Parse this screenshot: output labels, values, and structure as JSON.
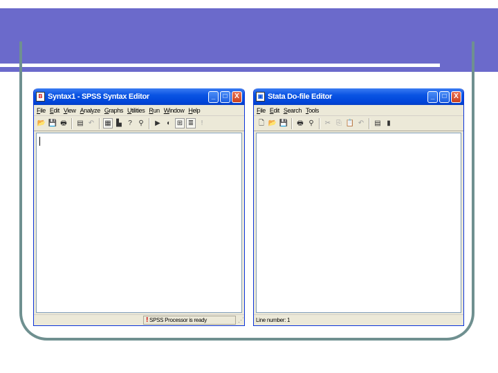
{
  "colors": {
    "slide_banner": "#6b6acb",
    "slide_frame": "#6f9090",
    "xp_titlebar": "#0a54e3",
    "xp_face": "#ece9d8"
  },
  "spss": {
    "title": "Syntax1 - SPSS Syntax Editor",
    "icon_glyph": "B",
    "menu": [
      "File",
      "Edit",
      "View",
      "Analyze",
      "Graphs",
      "Utilities",
      "Run",
      "Window",
      "Help"
    ],
    "toolbar": [
      {
        "icon": "open-folder-icon",
        "glyph": "📂"
      },
      {
        "icon": "save-icon",
        "glyph": "💾"
      },
      {
        "icon": "print-icon",
        "glyph": "🖶"
      },
      {
        "icon": "dialog-recall-icon",
        "glyph": "▤"
      },
      {
        "icon": "undo-icon",
        "glyph": "↶"
      },
      {
        "icon": "goto-data-icon",
        "glyph": "▦"
      },
      {
        "icon": "goto-chart-icon",
        "glyph": "▙"
      },
      {
        "icon": "find-variables-icon",
        "glyph": "?"
      },
      {
        "icon": "find-icon",
        "glyph": "⚲"
      },
      {
        "icon": "run-icon",
        "glyph": "▶"
      },
      {
        "icon": "syntax-help-icon",
        "glyph": "◐"
      },
      {
        "icon": "value-labels-icon",
        "glyph": "⊞"
      },
      {
        "icon": "use-sets-icon",
        "glyph": "≣"
      },
      {
        "icon": "info-icon",
        "glyph": "!"
      }
    ],
    "status": "SPSS Processor is ready",
    "min_glyph": "_",
    "max_glyph": "□",
    "close_glyph": "X",
    "grip_glyph": "⋰"
  },
  "stata": {
    "title": "Stata Do-file Editor",
    "icon_glyph": "▣",
    "menu": [
      "File",
      "Edit",
      "Search",
      "Tools"
    ],
    "toolbar": [
      {
        "icon": "new-file-icon",
        "glyph": "🗋"
      },
      {
        "icon": "open-icon",
        "glyph": "📂"
      },
      {
        "icon": "save-icon",
        "glyph": "💾"
      },
      {
        "icon": "print-icon",
        "glyph": "🖶"
      },
      {
        "icon": "find-icon",
        "glyph": "⚲"
      },
      {
        "icon": "cut-icon",
        "glyph": "✂"
      },
      {
        "icon": "copy-icon",
        "glyph": "⎘"
      },
      {
        "icon": "paste-icon",
        "glyph": "📋"
      },
      {
        "icon": "undo-icon",
        "glyph": "↶"
      },
      {
        "icon": "do-file-icon",
        "glyph": "▤"
      },
      {
        "icon": "run-icon",
        "glyph": "▮"
      }
    ],
    "status": "Line number: 1",
    "min_glyph": "_",
    "max_glyph": "□",
    "close_glyph": "X"
  }
}
